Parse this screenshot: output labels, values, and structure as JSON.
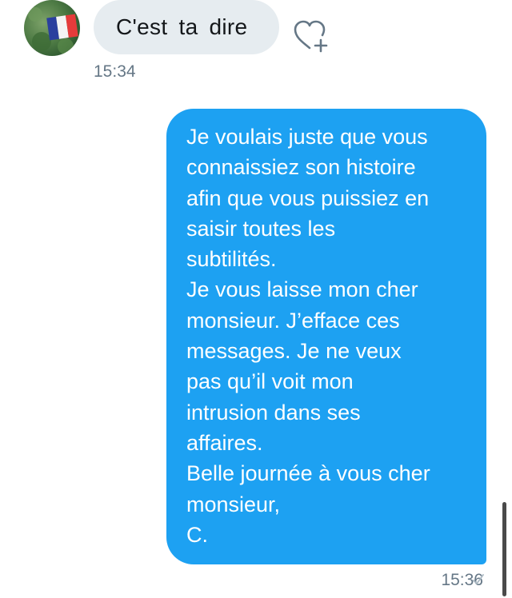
{
  "incoming": {
    "text": "C'est ta dire",
    "time": "15:34",
    "avatar_icon": "avatar-french-flag",
    "like_icon": "heart-plus-icon"
  },
  "outgoing": {
    "text": "Je voulais juste que vous\nconnaissiez son histoire\nafin que vous puissiez en\nsaisir toutes les\nsubtilités.\nJe vous laisse mon cher\nmonsieur. J’efface ces\nmessages. Je ne veux\npas qu’il voit mon\nintrusion dans ses\naffaires.\nBelle journée à vous cher\nmonsieur,\nC.",
    "time": "15:36",
    "status_icon": "checkmark-icon"
  },
  "colors": {
    "outgoing_bubble": "#1da1f2",
    "incoming_bubble": "#e6ecf0",
    "timestamp": "#657786"
  }
}
